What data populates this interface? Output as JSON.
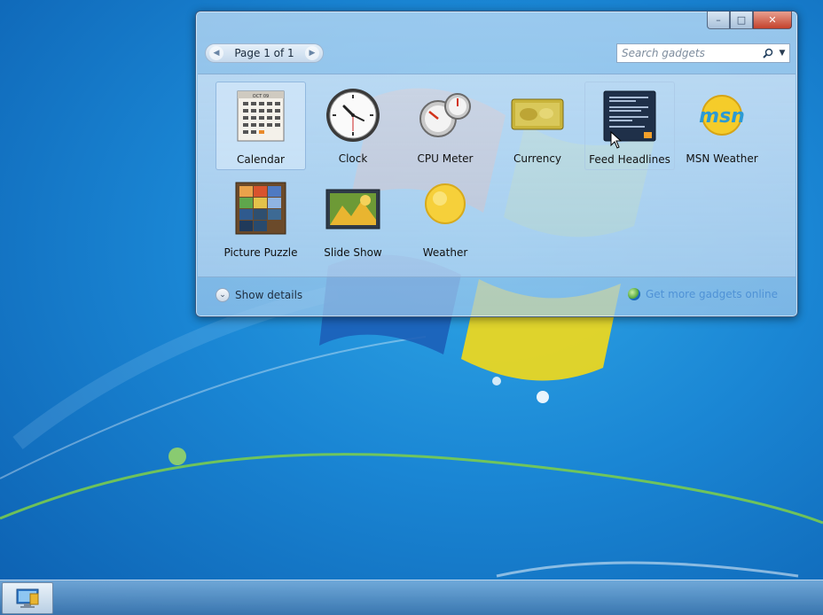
{
  "window": {
    "minimize_glyph": "–",
    "maximize_glyph": "□",
    "close_glyph": "✕"
  },
  "toolbar": {
    "prev_glyph": "◀",
    "page_text": "Page 1 of 1",
    "next_glyph": "▶",
    "search_placeholder": "Search gadgets",
    "search_icon": "magnifier-icon",
    "dropdown_glyph": "▼"
  },
  "gadgets": [
    {
      "label": "Calendar",
      "icon": "calendar-icon",
      "state": "selected"
    },
    {
      "label": "Clock",
      "icon": "clock-icon"
    },
    {
      "label": "CPU Meter",
      "icon": "cpu-meter-icon"
    },
    {
      "label": "Currency",
      "icon": "currency-icon"
    },
    {
      "label": "Feed Headlines",
      "icon": "feed-headlines-icon",
      "state": "hover"
    },
    {
      "label": "MSN Weather",
      "icon": "msn-weather-icon",
      "icon_text": "msn"
    },
    {
      "label": "Picture Puzzle",
      "icon": "picture-puzzle-icon"
    },
    {
      "label": "Slide Show",
      "icon": "slide-show-icon"
    },
    {
      "label": "Weather",
      "icon": "weather-icon"
    }
  ],
  "footer": {
    "details_glyph": "⌄",
    "show_details_label": "Show details",
    "more_gadgets_label": "Get more gadgets online"
  },
  "calendar_icon_month": "OCT 09",
  "colors": {
    "desktop": "#1a86d4",
    "selection": "#dcecfc",
    "link": "#4f92d6"
  }
}
